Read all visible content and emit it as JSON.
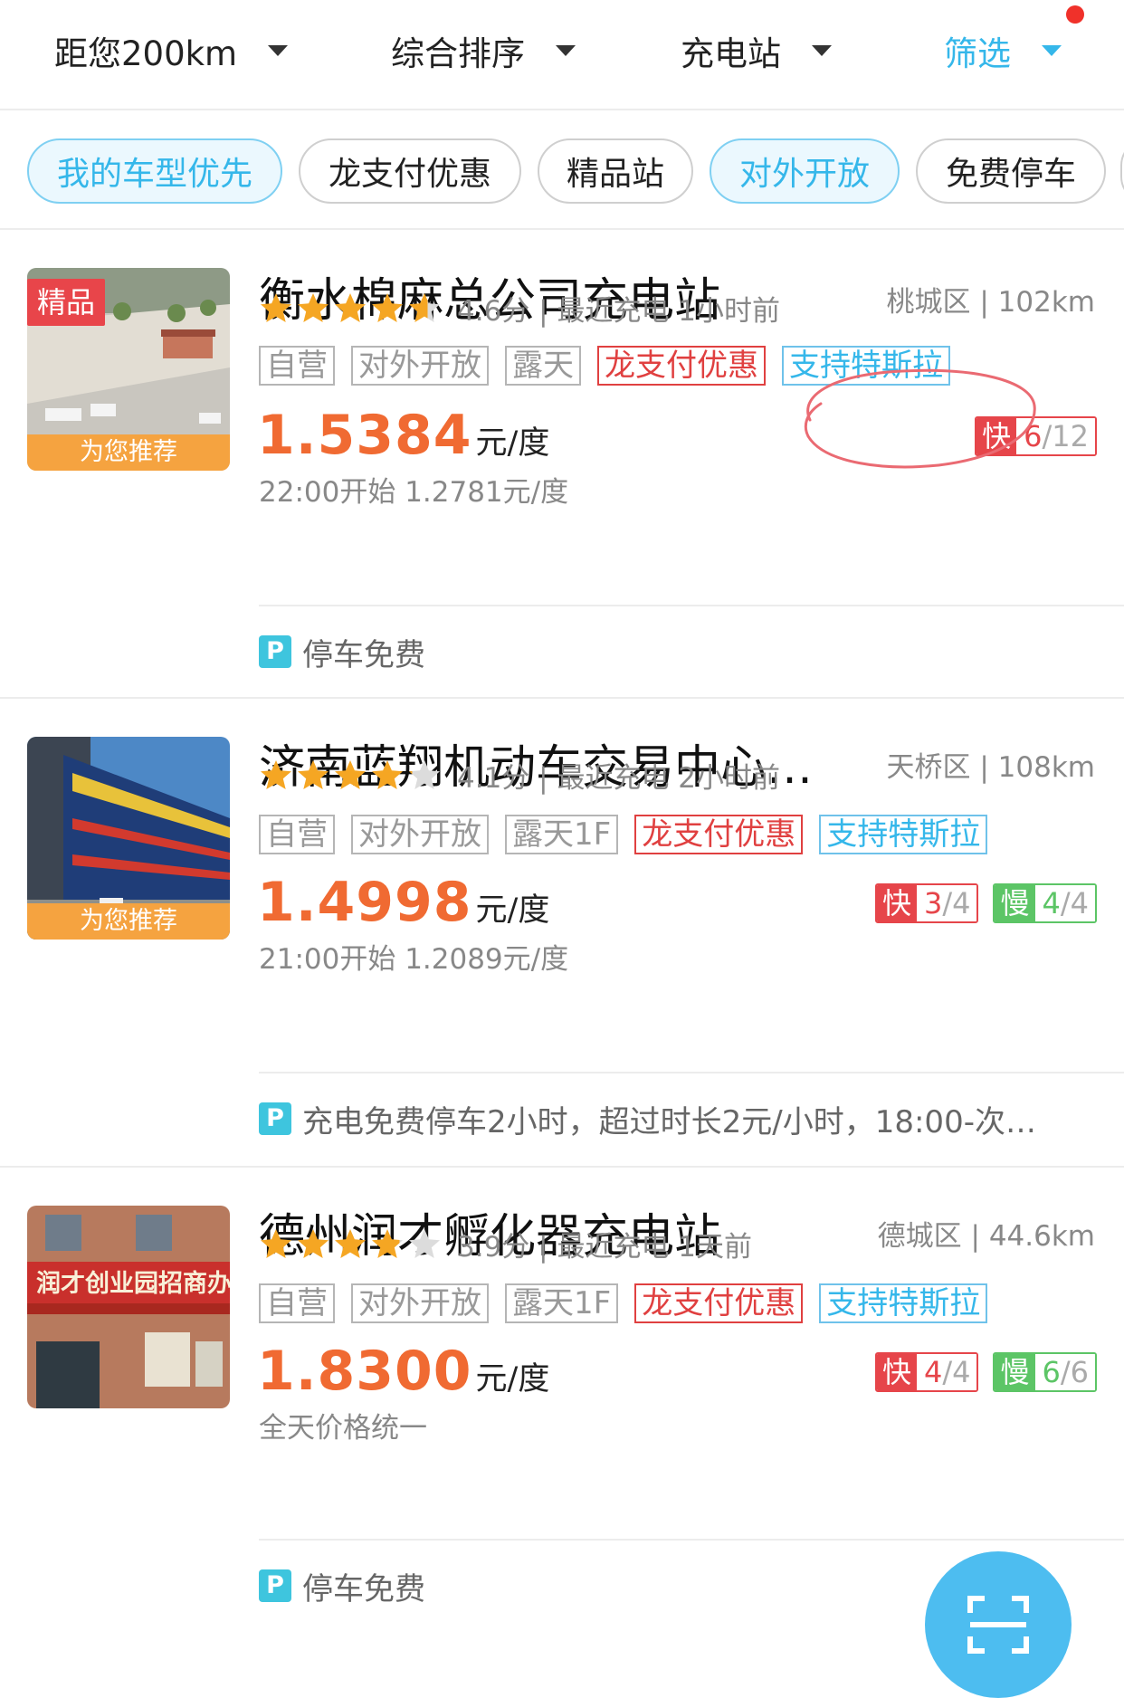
{
  "filters": {
    "distance": "距您200km",
    "sort": "综合排序",
    "type": "充电站",
    "filter": "筛选"
  },
  "chips": [
    "我的车型优先",
    "龙支付优惠",
    "精品站",
    "对外开放",
    "免费停车"
  ],
  "stations": [
    {
      "name": "衡水棉麻总公司充电站",
      "district": "桃城区 | 102km",
      "premium_label": "精品",
      "recommend_label": "为您推荐",
      "rating": 4.6,
      "rating_text": "4.6分 | 最近充电 1小时前",
      "tags": [
        "自营",
        "对外开放",
        "露天",
        "龙支付优惠",
        "支持特斯拉"
      ],
      "price": "1.5384",
      "unit": "元/度",
      "sub_price": "22:00开始 1.2781元/度",
      "fast": {
        "label": "快",
        "avail": "6",
        "total": "/12"
      },
      "parking": "停车免费"
    },
    {
      "name": "济南蓝翔机动车交易中心…",
      "district": "天桥区 | 108km",
      "recommend_label": "为您推荐",
      "rating": 4.1,
      "rating_text": "4.1分 | 最近充电 2小时前",
      "tags": [
        "自营",
        "对外开放",
        "露天1F",
        "龙支付优惠",
        "支持特斯拉"
      ],
      "price": "1.4998",
      "unit": "元/度",
      "sub_price": "21:00开始 1.2089元/度",
      "fast": {
        "label": "快",
        "avail": "3",
        "total": "/4"
      },
      "slow": {
        "label": "慢",
        "avail": "4",
        "total": "/4"
      },
      "parking": "充电免费停车2小时，超过时长2元/小时，18:00-次…"
    },
    {
      "name": "德州润才孵化器充电站",
      "district": "德城区 | 44.6km",
      "rating": 3.9,
      "rating_text": "3.9分 | 最近充电 1天前",
      "tags": [
        "自营",
        "对外开放",
        "露天1F",
        "龙支付优惠",
        "支持特斯拉"
      ],
      "price": "1.8300",
      "unit": "元/度",
      "sub_price": "全天价格统一",
      "fast": {
        "label": "快",
        "avail": "4",
        "total": "/4"
      },
      "slow": {
        "label": "慢",
        "avail": "6",
        "total": "/6"
      },
      "parking": "停车免费",
      "photo_sign": "润才创业园招商办"
    }
  ],
  "parking_icon": "P",
  "colors": {
    "accent": "#35b7ea",
    "price": "#f06a32",
    "fast": "#e6454a",
    "slow": "#5cc566",
    "star": "#f5a623"
  }
}
